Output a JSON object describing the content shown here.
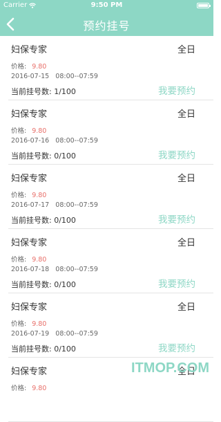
{
  "status_bar": {
    "carrier": "Carrier",
    "time": "9:50 PM"
  },
  "nav": {
    "title": "预约挂号"
  },
  "labels": {
    "price": "价格:",
    "count": "当前挂号数:",
    "book": "我要预约"
  },
  "items": [
    {
      "dept": "妇保专家",
      "period": "全日",
      "price": "9.80",
      "date": "2016-07-15",
      "time": "08:00--07:59",
      "count": "1/100"
    },
    {
      "dept": "妇保专家",
      "period": "全日",
      "price": "9.80",
      "date": "2016-07-16",
      "time": "08:00--07:59",
      "count": "0/100"
    },
    {
      "dept": "妇保专家",
      "period": "全日",
      "price": "9.80",
      "date": "2016-07-17",
      "time": "08:00--07:59",
      "count": "0/100"
    },
    {
      "dept": "妇保专家",
      "period": "全日",
      "price": "9.80",
      "date": "2016-07-18",
      "time": "08:00--07:59",
      "count": "0/100"
    },
    {
      "dept": "妇保专家",
      "period": "全日",
      "price": "9.80",
      "date": "2016-07-19",
      "time": "08:00--07:59",
      "count": "0/100"
    },
    {
      "dept": "妇保专家",
      "period": "全日",
      "price": "9.80",
      "date": "",
      "time": "",
      "count": ""
    }
  ],
  "watermark": "ITMOP.COM",
  "colors": {
    "accent": "#8dd7c5",
    "price": "#e8706a"
  }
}
